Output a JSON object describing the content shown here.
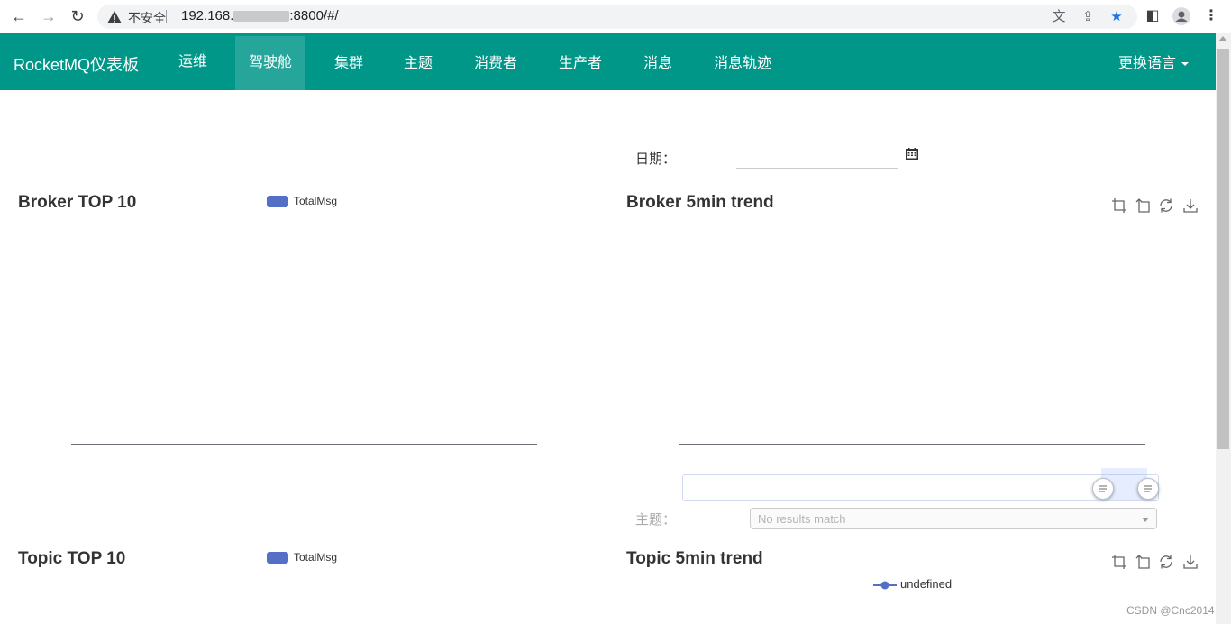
{
  "browser": {
    "security_label": "不安全",
    "url_prefix": "192.168.",
    "url_suffix": ":8800/#/"
  },
  "app": {
    "brand": "RocketMQ仪表板",
    "nav": [
      {
        "label": "运维",
        "active": false
      },
      {
        "label": "驾驶舱",
        "active": true
      },
      {
        "label": "集群",
        "active": false
      },
      {
        "label": "主题",
        "active": false
      },
      {
        "label": "消费者",
        "active": false
      },
      {
        "label": "生产者",
        "active": false
      },
      {
        "label": "消息",
        "active": false
      },
      {
        "label": "消息轨迹",
        "active": false
      }
    ],
    "language_menu": "更换语言"
  },
  "dashboard": {
    "date_label": "日期：",
    "date_value": "",
    "topic_label": "主题：",
    "topic_select_placeholder": "No results match",
    "broker_top10": {
      "title": "Broker TOP 10",
      "legend": "TotalMsg"
    },
    "broker_trend": {
      "title": "Broker 5min trend"
    },
    "topic_top10": {
      "title": "Topic TOP 10",
      "legend": "TotalMsg"
    },
    "topic_trend": {
      "title": "Topic 5min trend",
      "legend": "undefined"
    }
  },
  "colors": {
    "navbar": "#009688",
    "nav_active": "#26a69a",
    "series": "#5470c6"
  },
  "watermark": "CSDN @Cnc2014"
}
